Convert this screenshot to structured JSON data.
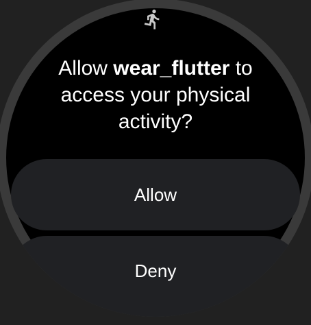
{
  "dialog": {
    "icon": "directions-run-icon",
    "title_prefix": "Allow ",
    "app_name": "wear_flutter",
    "title_suffix": " to access your physical activity?",
    "allow_label": "Allow",
    "deny_label": "Deny"
  },
  "colors": {
    "button_bg": "#202124",
    "icon": "#c8c8c8"
  }
}
